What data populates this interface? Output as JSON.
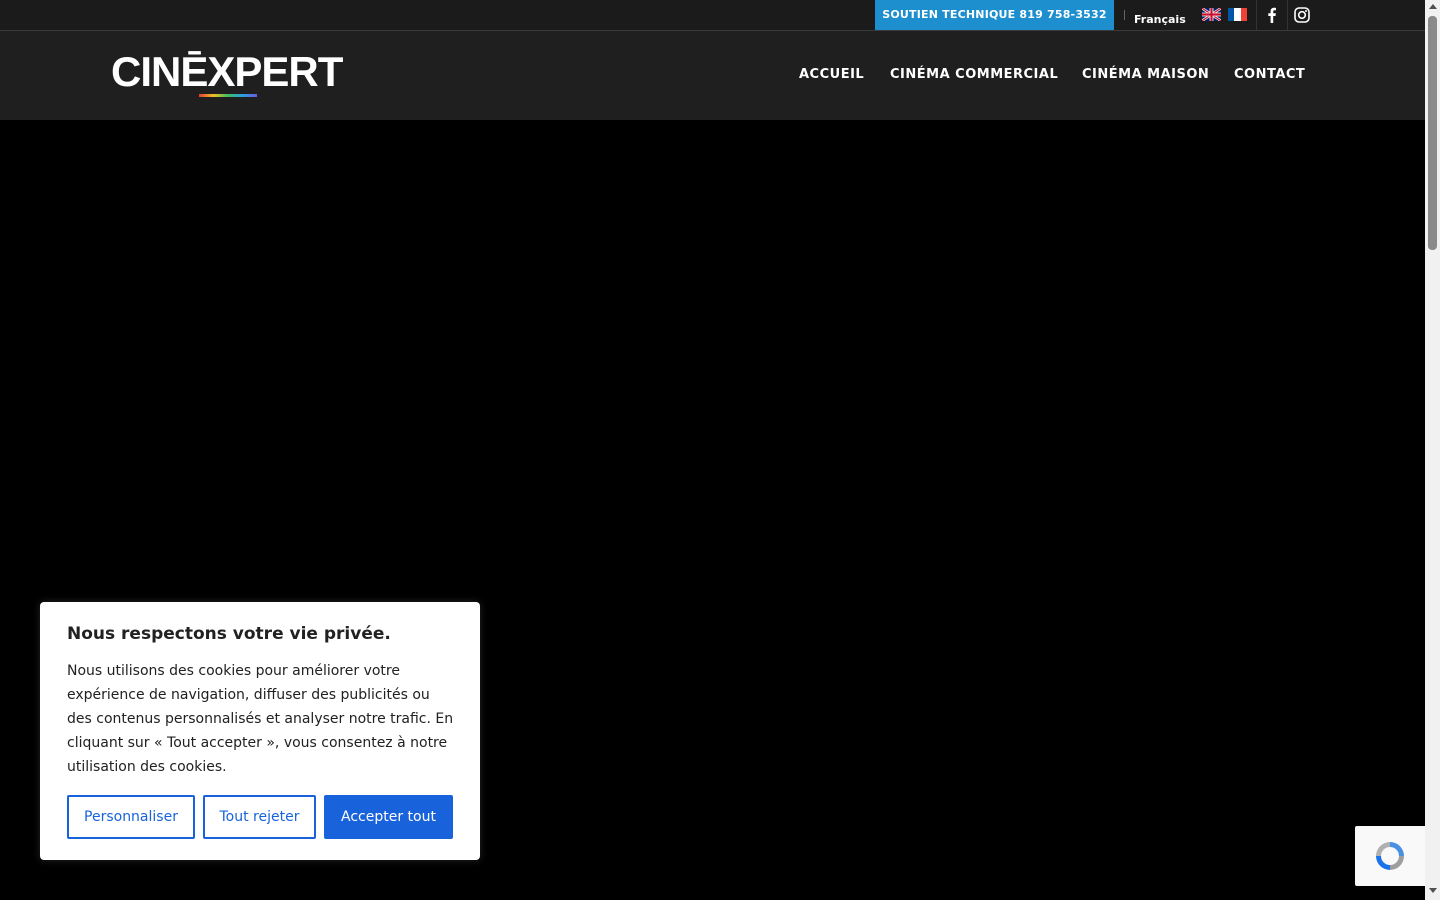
{
  "topbar": {
    "support_label": "SOUTIEN TECHNIQUE 819 758-3532",
    "language_label": "Français",
    "languages": [
      {
        "code": "en",
        "icon": "uk-flag-icon"
      },
      {
        "code": "fr",
        "icon": "france-flag-icon"
      }
    ],
    "social": [
      {
        "name": "facebook",
        "icon": "facebook-icon"
      },
      {
        "name": "instagram",
        "icon": "instagram-icon"
      }
    ]
  },
  "header": {
    "logo_text": "CINĒXPERT",
    "nav": [
      "ACCUEIL",
      "CINÉMA COMMERCIAL",
      "CINÉMA MAISON",
      "CONTACT"
    ]
  },
  "cookie_banner": {
    "title": "Nous respectons votre vie privée.",
    "text": "Nous utilisons des cookies pour améliorer votre expérience de navigation, diffuser des publicités ou des contenus personnalisés et analyser notre trafic. En cliquant sur « Tout accepter », vous consentez à notre utilisation des cookies.",
    "customize_label": "Personnaliser",
    "reject_label": "Tout rejeter",
    "accept_label": "Accepter tout"
  },
  "colors": {
    "support_bg": "#1d8fcf",
    "accept_bg": "#1863dc",
    "header_bg": "#1f1f1f",
    "topbar_bg": "#1b1b1b"
  }
}
